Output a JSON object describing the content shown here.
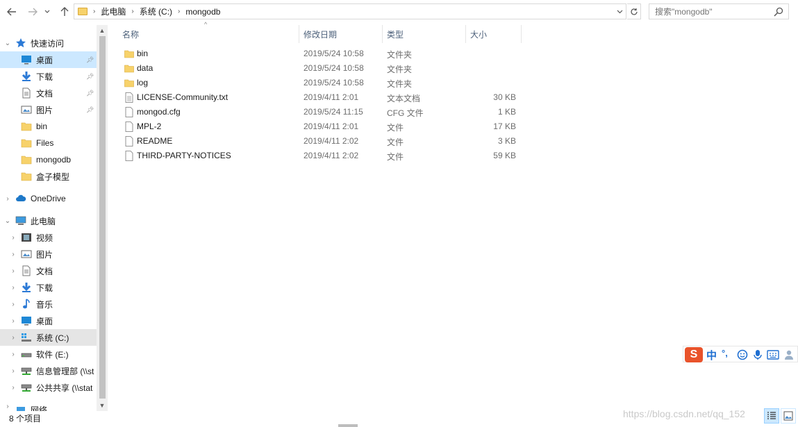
{
  "address_bar": {
    "crumbs": [
      "此电脑",
      "系统 (C:)",
      "mongodb"
    ],
    "search_placeholder": "搜索\"mongodb\""
  },
  "sidebar": {
    "quick_access": "快速访问",
    "quick_items": [
      "桌面",
      "下载",
      "文档",
      "图片",
      "bin",
      "Files",
      "mongodb",
      "盒子模型"
    ],
    "onedrive": "OneDrive",
    "this_pc": "此电脑",
    "pc_items": [
      "视频",
      "图片",
      "文档",
      "下载",
      "音乐",
      "桌面",
      "系统 (C:)",
      "软件 (E:)",
      "信息管理部 (\\\\st",
      "公共共享 (\\\\stat"
    ],
    "network": "网络"
  },
  "columns": {
    "name": "名称",
    "date": "修改日期",
    "type": "类型",
    "size": "大小"
  },
  "files": [
    {
      "name": "bin",
      "date": "2019/5/24 10:58",
      "type": "文件夹",
      "size": "",
      "icon": "folder-icon"
    },
    {
      "name": "data",
      "date": "2019/5/24 10:58",
      "type": "文件夹",
      "size": "",
      "icon": "folder-icon"
    },
    {
      "name": "log",
      "date": "2019/5/24 10:58",
      "type": "文件夹",
      "size": "",
      "icon": "folder-icon"
    },
    {
      "name": "LICENSE-Community.txt",
      "date": "2019/4/11 2:01",
      "type": "文本文档",
      "size": "30 KB",
      "icon": "text-file-icon"
    },
    {
      "name": "mongod.cfg",
      "date": "2019/5/24 11:15",
      "type": "CFG 文件",
      "size": "1 KB",
      "icon": "file-icon"
    },
    {
      "name": "MPL-2",
      "date": "2019/4/11 2:01",
      "type": "文件",
      "size": "17 KB",
      "icon": "file-icon"
    },
    {
      "name": "README",
      "date": "2019/4/11 2:02",
      "type": "文件",
      "size": "3 KB",
      "icon": "file-icon"
    },
    {
      "name": "THIRD-PARTY-NOTICES",
      "date": "2019/4/11 2:02",
      "type": "文件",
      "size": "59 KB",
      "icon": "file-icon"
    }
  ],
  "status": {
    "item_count": "8 个项目"
  },
  "watermark": "https://blog.csdn.net/qq_152",
  "ime": {
    "logo": "S",
    "mode": "中",
    "punct": "°,"
  },
  "colors": {
    "selected_bg": "#cce8ff",
    "header_text": "#4c607a",
    "folder": "#f7d26b",
    "ime_brand": "#e9532b"
  }
}
